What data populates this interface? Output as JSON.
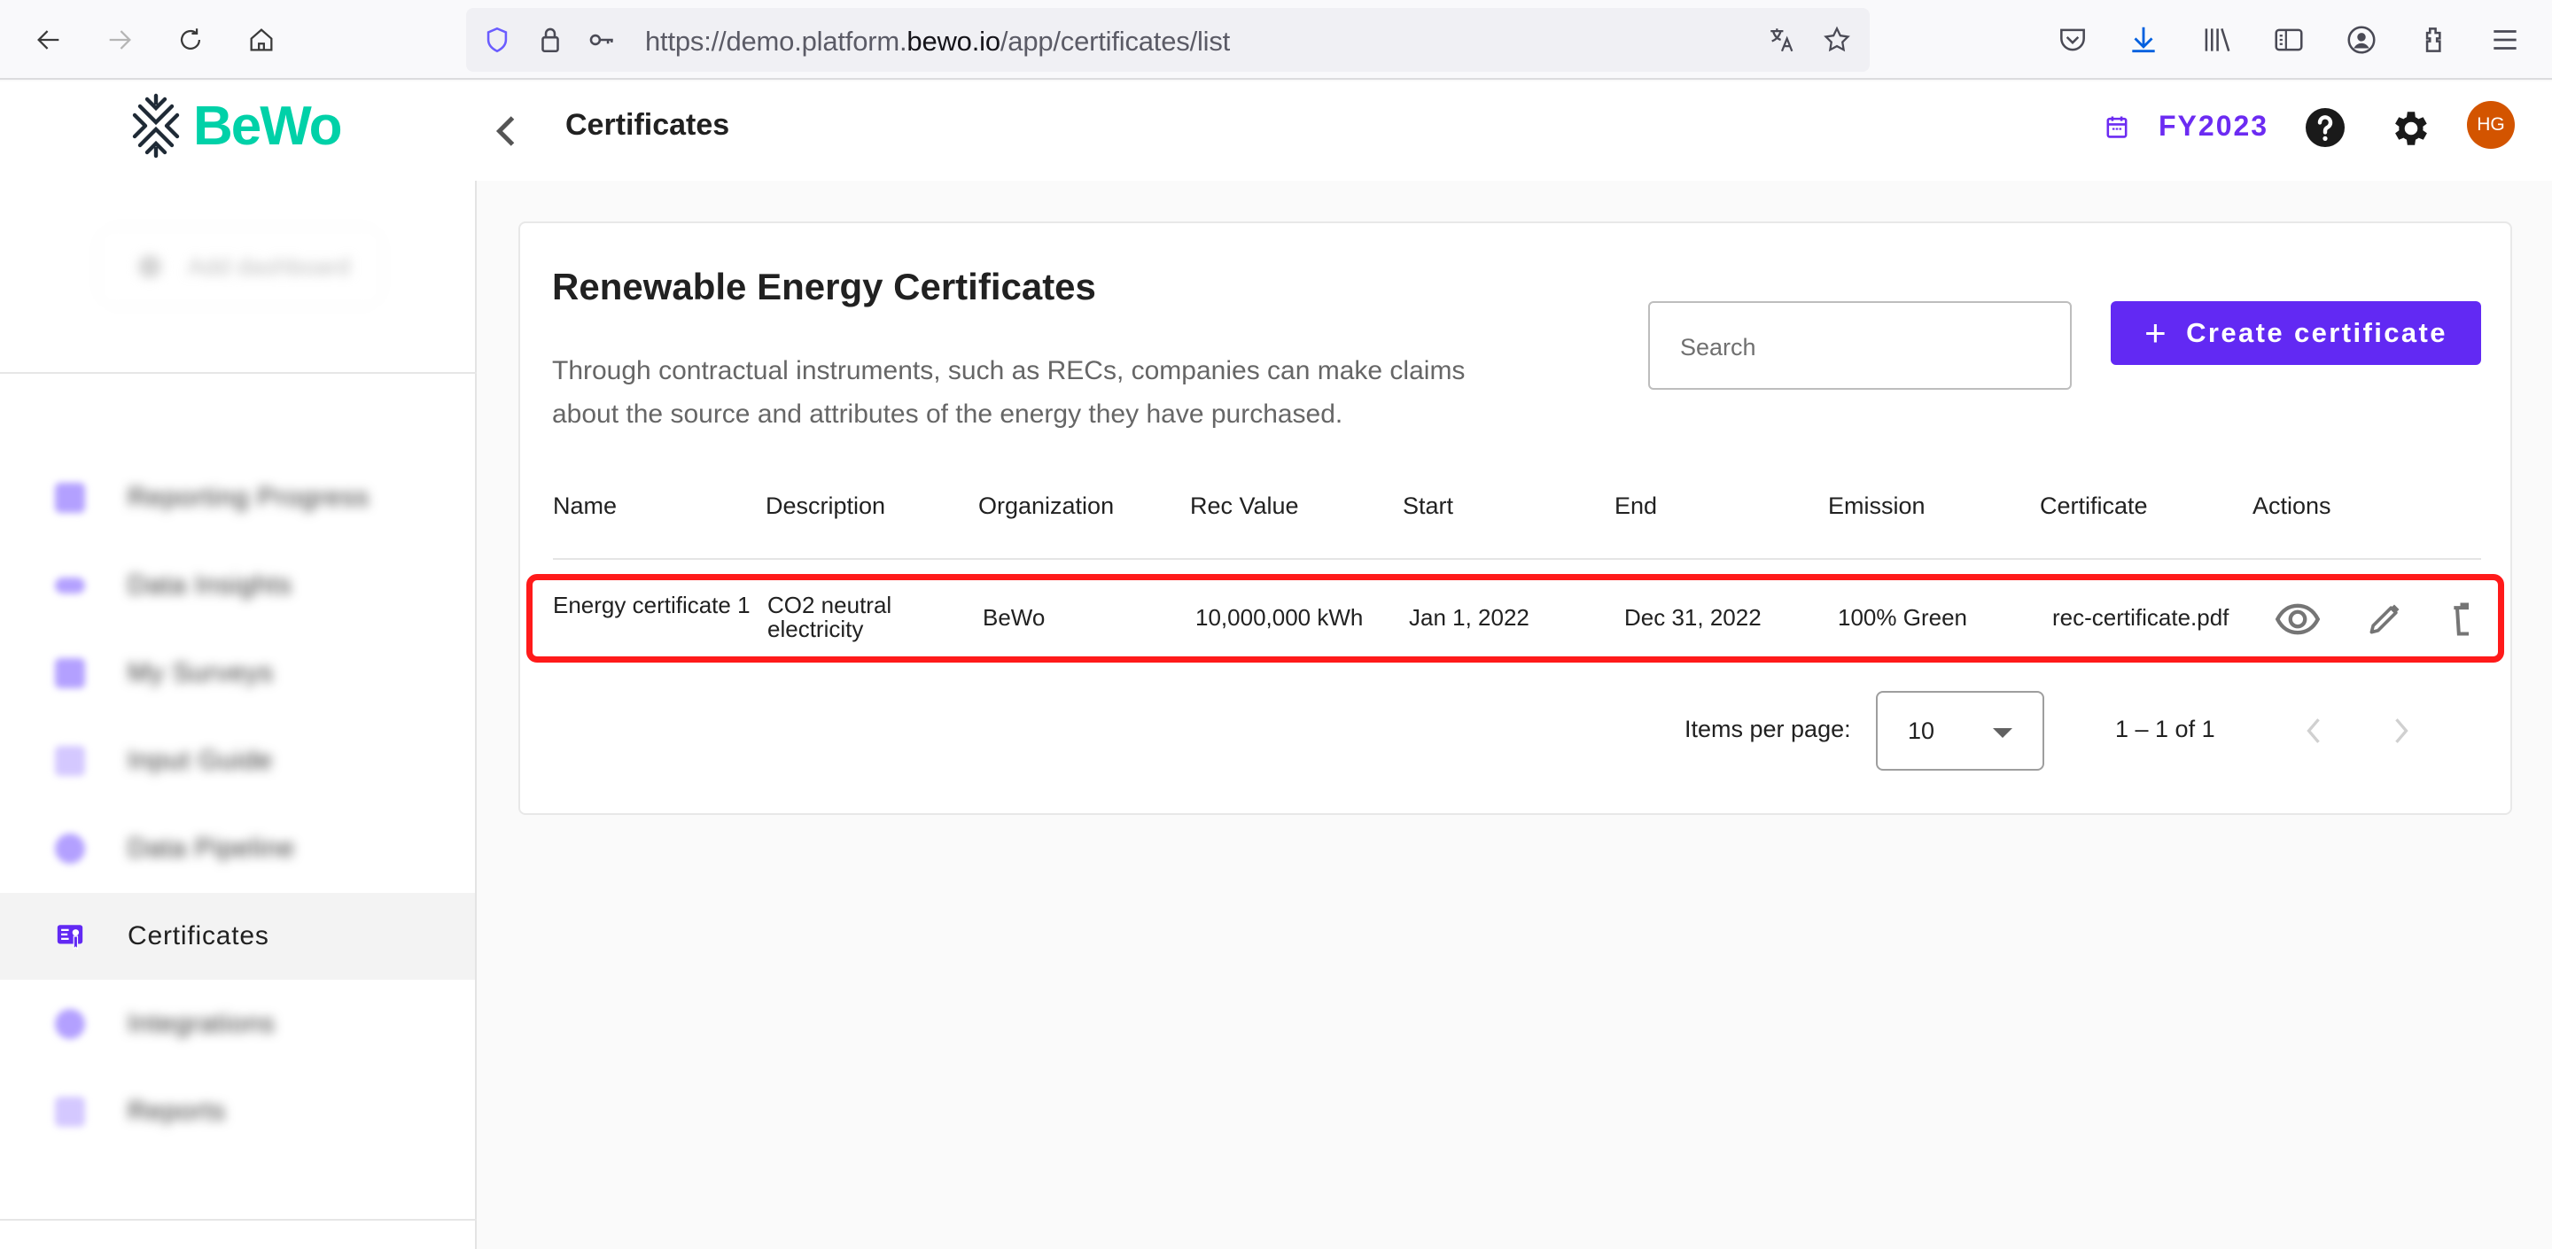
{
  "browser": {
    "url_prefix": "https://demo.platform.",
    "url_host": "bewo.io",
    "url_path": "/app/certificates/list",
    "icons": [
      "back-icon",
      "forward-icon",
      "reload-icon",
      "home-icon",
      "shield-icon",
      "lock-icon",
      "key-icon",
      "translate-icon",
      "bookmark-star-icon",
      "pocket-icon",
      "download-icon",
      "library-icon",
      "sidebar-icon",
      "account-icon",
      "extensions-icon",
      "menu-icon"
    ]
  },
  "header": {
    "logo_text": "BeWo",
    "title": "Certificates",
    "fiscal_year": "FY2023",
    "avatar_initials": "HG",
    "brand_color": "#00d1a8",
    "accent_color": "#6229f3",
    "avatar_color": "#d35400"
  },
  "sidebar": {
    "add_dashboard_label": "Add dashboard",
    "items": [
      {
        "label": "Reporting Progress",
        "active": false
      },
      {
        "label": "Data Insights",
        "active": false
      },
      {
        "label": "My Surveys",
        "active": false
      },
      {
        "label": "Input Guide",
        "active": false
      },
      {
        "label": "Data Pipeline",
        "active": false
      },
      {
        "label": "Certificates",
        "active": true
      },
      {
        "label": "Integrations",
        "active": false
      },
      {
        "label": "Reports",
        "active": false
      }
    ]
  },
  "card": {
    "title": "Renewable Energy Certificates",
    "description": "Through contractual instruments, such as RECs, companies can make claims about the source and attributes of the energy they have purchased.",
    "search_placeholder": "Search",
    "search_value": "",
    "create_label": "Create certificate"
  },
  "table": {
    "columns": [
      "Name",
      "Description",
      "Organization",
      "Rec Value",
      "Start",
      "End",
      "Emission",
      "Certificate",
      "Actions"
    ],
    "rows": [
      {
        "name": "Energy certificate 1",
        "description": "CO2 neutral electricity",
        "organization": "BeWo",
        "rec_value": "10,000,000 kWh",
        "start": "Jan 1, 2022",
        "end": "Dec 31, 2022",
        "emission": "100% Green",
        "certificate": "rec-certificate.pdf",
        "actions": [
          "view",
          "edit",
          "delete"
        ]
      }
    ]
  },
  "pagination": {
    "items_per_page_label": "Items per page:",
    "items_per_page": "10",
    "range_label": "1 – 1 of 1"
  }
}
